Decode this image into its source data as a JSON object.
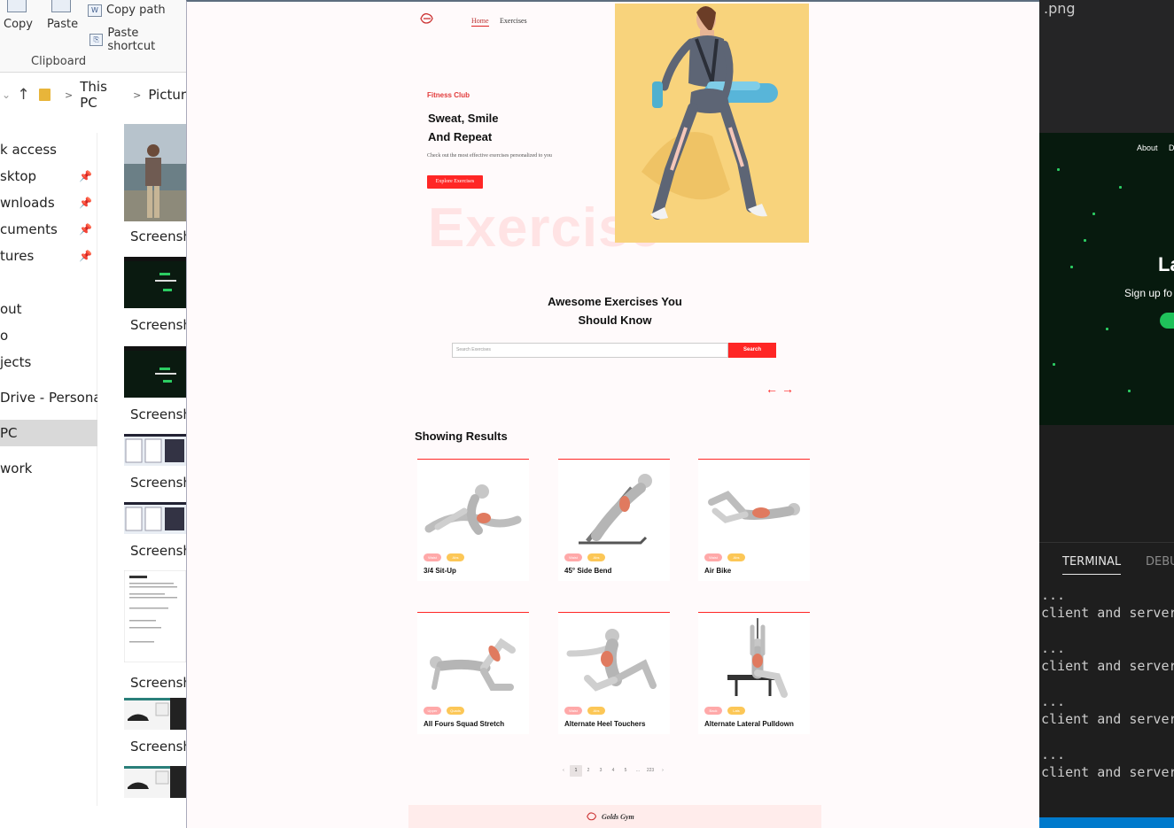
{
  "explorer": {
    "ribbon": {
      "copy_label": "Copy",
      "paste_label": "Paste",
      "copy_path_label": "Copy path",
      "paste_shortcut_label": "Paste shortcut",
      "group_label": "Clipboard"
    },
    "address": {
      "crumb1": "This PC",
      "crumb2": "Pictur"
    },
    "nav_items": [
      "k access",
      "sktop",
      "wnloads",
      "cuments",
      "tures",
      "out",
      "o",
      "jects",
      "Drive - Personal",
      "PC",
      "work"
    ],
    "thumb_label": "Screensho"
  },
  "vscode": {
    "tab_name": ".png",
    "preview": {
      "nav_about": "About",
      "nav_d": "D",
      "big_letter": "La",
      "subtitle": "Sign up fo"
    },
    "panel_tabs": {
      "terminal": "TERMINAL",
      "debug": "DEBU"
    },
    "terminal_lines": [
      "...",
      "client and server",
      "...",
      "client and server",
      "...",
      "client and server",
      "...",
      "client and server"
    ]
  },
  "app": {
    "nav": {
      "home": "Home",
      "exercises": "Exercises"
    },
    "hero": {
      "kicker": "Fitness Club",
      "title_line1": "Sweat, Smile",
      "title_line2": "And Repeat",
      "description": "Check out the most effective exercises personalized to you",
      "button": "Explore Exercises",
      "watermark": "Exercise"
    },
    "search": {
      "title_line1": "Awesome Exercises You",
      "title_line2": "Should Know",
      "placeholder": "Search Exercises",
      "button": "Search"
    },
    "arrows": {
      "left": "←",
      "right": "→"
    },
    "results_title": "Showing Results",
    "cards": [
      {
        "name": "3/4 Sit-Up",
        "tag1": "Waist",
        "tag2": "Abs"
      },
      {
        "name": "45° Side Bend",
        "tag1": "Waist",
        "tag2": "Abs"
      },
      {
        "name": "Air Bike",
        "tag1": "Waist",
        "tag2": "Abs"
      },
      {
        "name": "All Fours Squad Stretch",
        "tag1": "Upper Legs",
        "tag2": "Quads"
      },
      {
        "name": "Alternate Heel Touchers",
        "tag1": "Waist",
        "tag2": "Abs"
      },
      {
        "name": "Alternate Lateral Pulldown",
        "tag1": "Back",
        "tag2": "Lats"
      }
    ],
    "pagination": [
      "‹",
      "1",
      "2",
      "3",
      "4",
      "5",
      "...",
      "223",
      "›"
    ],
    "footer": {
      "brand": "Golds Gym"
    },
    "colors": {
      "accent": "#ff2625",
      "tag_a": "#ffa9a9",
      "tag_b": "#fcc757",
      "hero_bg": "#f8d37c"
    }
  }
}
